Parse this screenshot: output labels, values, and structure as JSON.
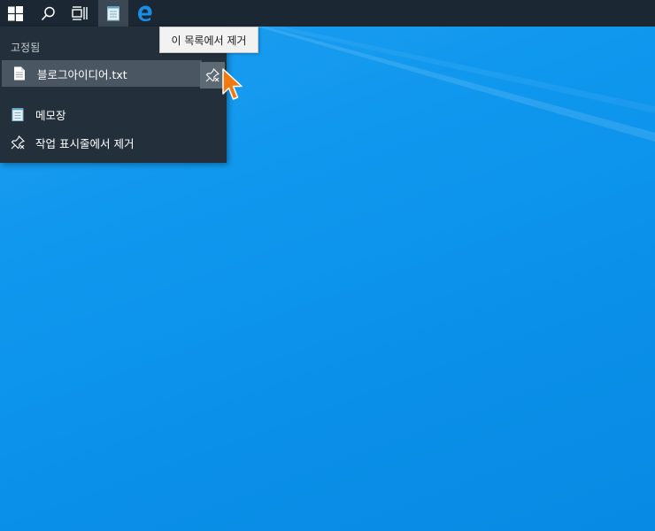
{
  "taskbar": {
    "buttons": [
      {
        "name": "windows-icon"
      },
      {
        "name": "search-icon"
      },
      {
        "name": "task-view-icon"
      },
      {
        "name": "notepad-icon",
        "active": true
      },
      {
        "name": "edge-icon"
      }
    ]
  },
  "jumplist": {
    "pinned_header": "고정됨",
    "pinned_item": "블로그아이디어.txt",
    "app_name": "메모장",
    "unpin_taskbar": "작업 표시줄에서 제거"
  },
  "tooltip": {
    "text": "이 목록에서 제거"
  },
  "colors": {
    "taskbar": "#1b2733",
    "jumplist": "#23303b",
    "highlight": "#4a5661",
    "desktop": "#0f97ee",
    "cursor": "#f07a10"
  }
}
